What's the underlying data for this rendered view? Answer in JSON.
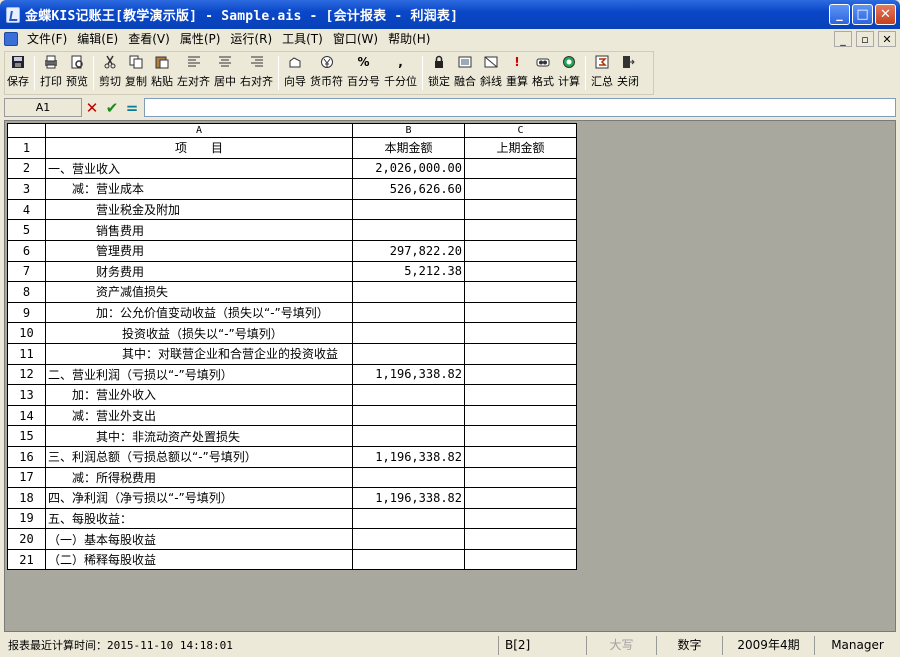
{
  "window": {
    "title": "金蝶KIS记账王[教学演示版] - Sample.ais - [会计报表 - 利润表]",
    "controls": {
      "minimize": "_",
      "maximize": "□",
      "close": "✕"
    }
  },
  "menu": {
    "items": [
      "文件(F)",
      "编辑(E)",
      "查看(V)",
      "属性(P)",
      "运行(R)",
      "工具(T)",
      "窗口(W)",
      "帮助(H)"
    ],
    "mdi": {
      "minimize": "_",
      "restore": "▫",
      "close": "✕"
    }
  },
  "toolbar": {
    "save": "保存",
    "print": "打印",
    "preview": "预览",
    "cut": "剪切",
    "copy": "复制",
    "paste": "粘贴",
    "align_left": "左对齐",
    "align_center": "居中",
    "align_right": "右对齐",
    "wizard": "向导",
    "currency": "货币符",
    "percent": "百分号",
    "thousands": "千分位",
    "lock": "锁定",
    "merge": "融合",
    "diagonal": "斜线",
    "recalc": "重算",
    "format": "格式",
    "calc": "计算",
    "summary": "汇总",
    "close": "关闭",
    "icons": {
      "percent_glyph": "%",
      "thousands_glyph": ",",
      "recalc_glyph": "!"
    }
  },
  "formula": {
    "cell_ref": "A1",
    "cancel": "✕",
    "confirm": "✔",
    "equals": "="
  },
  "sheet": {
    "columns": [
      "A",
      "B",
      "C"
    ],
    "header": {
      "row": "1",
      "a": "项　　目",
      "b": "本期金额",
      "c": "上期金额"
    },
    "rows": [
      {
        "n": "2",
        "a": "一、营业收入",
        "indent": 0,
        "b": "2,026,000.00",
        "c": ""
      },
      {
        "n": "3",
        "a": "减：营业成本",
        "indent": 1,
        "b": "526,626.60",
        "c": ""
      },
      {
        "n": "4",
        "a": "营业税金及附加",
        "indent": 2,
        "b": "",
        "c": ""
      },
      {
        "n": "5",
        "a": "销售费用",
        "indent": 2,
        "b": "",
        "c": ""
      },
      {
        "n": "6",
        "a": "管理费用",
        "indent": 2,
        "b": "297,822.20",
        "c": ""
      },
      {
        "n": "7",
        "a": "财务费用",
        "indent": 2,
        "b": "5,212.38",
        "c": ""
      },
      {
        "n": "8",
        "a": "资产减值损失",
        "indent": 2,
        "b": "",
        "c": ""
      },
      {
        "n": "9",
        "a": "加：公允价值变动收益（损失以“-”号填列）",
        "indent": 2,
        "b": "",
        "c": ""
      },
      {
        "n": "10",
        "a": "投资收益（损失以“-”号填列）",
        "indent": 3,
        "b": "",
        "c": ""
      },
      {
        "n": "11",
        "a": "其中：对联营企业和合营企业的投资收益",
        "indent": 3,
        "b": "",
        "c": ""
      },
      {
        "n": "12",
        "a": "二、营业利润（亏损以“-”号填列）",
        "indent": 0,
        "b": "1,196,338.82",
        "c": ""
      },
      {
        "n": "13",
        "a": "加：营业外收入",
        "indent": 1,
        "b": "",
        "c": ""
      },
      {
        "n": "14",
        "a": "减：营业外支出",
        "indent": 1,
        "b": "",
        "c": ""
      },
      {
        "n": "15",
        "a": "其中：非流动资产处置损失",
        "indent": 2,
        "b": "",
        "c": ""
      },
      {
        "n": "16",
        "a": "三、利润总额（亏损总额以“-”号填列）",
        "indent": 0,
        "b": "1,196,338.82",
        "c": ""
      },
      {
        "n": "17",
        "a": "减：所得税费用",
        "indent": 1,
        "b": "",
        "c": ""
      },
      {
        "n": "18",
        "a": "四、净利润（净亏损以“-”号填列）",
        "indent": 0,
        "b": "1,196,338.82",
        "c": ""
      },
      {
        "n": "19",
        "a": "五、每股收益：",
        "indent": 0,
        "b": "",
        "c": ""
      },
      {
        "n": "20",
        "a": "（一）基本每股收益",
        "indent": 0,
        "b": "",
        "c": ""
      },
      {
        "n": "21",
        "a": "（二）稀释每股收益",
        "indent": 0,
        "b": "",
        "c": ""
      }
    ]
  },
  "status": {
    "calc_time": "报表最近计算时间：2015-11-10 14:18:01",
    "cell": "B[2]",
    "caps": "大写",
    "numlock": "数字",
    "period": "2009年4期",
    "user": "Manager"
  }
}
